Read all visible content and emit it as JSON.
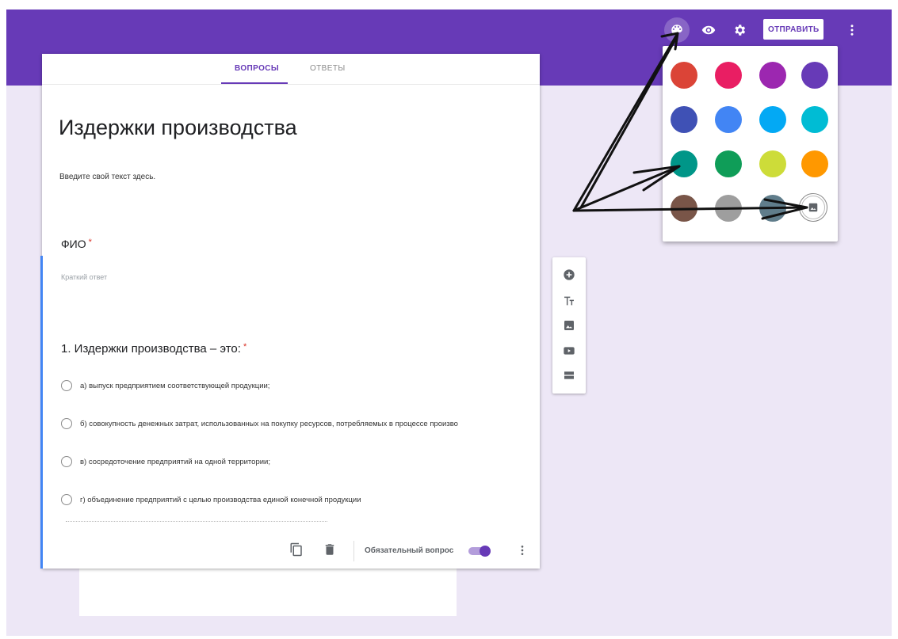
{
  "toolbar": {
    "send_label": "ОТПРАВИТЬ",
    "icons": [
      "palette-icon",
      "preview-icon",
      "settings-icon",
      "more-vert-icon"
    ],
    "accent_color": "#673ab7"
  },
  "tabs": {
    "questions": "ВОПРОСЫ",
    "responses": "ОТВЕТЫ"
  },
  "form": {
    "title": "Издержки производства",
    "description": "Введите свой текст здесь."
  },
  "questions": [
    {
      "label": "ФИО",
      "required_mark": "*",
      "placeholder": "Краткий ответ"
    },
    {
      "label": "1. Издержки производства – это:",
      "required_mark": "*",
      "options": [
        "а) выпуск предприятием соответствующей продукции;",
        "б) совокупность денежных затрат, использованных на покупку ресурсов, потребляемых в процессе произво",
        "в) сосредоточение предприятий на одной территории;",
        "г) объединение предприятий с целью производства единой конечной продукции"
      ]
    }
  ],
  "question_footer": {
    "required_label": "Обязательный вопрос",
    "required_on": true
  },
  "side_tools": [
    "add-question-icon",
    "add-title-icon",
    "add-image-icon",
    "add-video-icon",
    "add-section-icon"
  ],
  "theme_palette": {
    "colors": [
      "#db4437",
      "#e91e63",
      "#9c27b0",
      "#673ab7",
      "#3f51b5",
      "#4285f4",
      "#03a9f4",
      "#00bcd4",
      "#009688",
      "#0f9d58",
      "#cddc39",
      "#ff9800",
      "#795548",
      "#9e9e9e",
      "#607d8b"
    ],
    "image_option_icon": "image-icon"
  }
}
